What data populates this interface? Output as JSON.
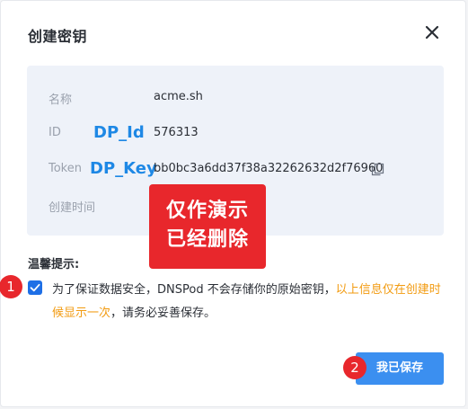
{
  "dialog": {
    "title": "创建密钥"
  },
  "fields": {
    "name_label": "名称",
    "name_value": "acme.sh",
    "id_label": "ID",
    "id_value": "576313",
    "token_label": "Token",
    "token_value": "bb0bc3a6dd37f38a32262632d2f76960",
    "created_label": "创建时间"
  },
  "annotations": {
    "id_tag": "DP_Id",
    "key_tag": "DP_Key",
    "overlay_line1": "仅作演示",
    "overlay_line2": "已经删除",
    "badge_1": "1",
    "badge_2": "2"
  },
  "tips": {
    "title": "温馨提示:",
    "text_part1": "为了保证数据安全，DNSPod 不会存储你的原始密钥，",
    "text_highlight": "以上信息仅在创建时候显示一次",
    "text_part2": "，请务必妥善保存。",
    "checked": true
  },
  "footer": {
    "confirm_label": "我已保存"
  },
  "colors": {
    "primary": "#3b8ff0",
    "checkbox": "#1e6fe6",
    "highlight": "#f29b11",
    "overlay": "#e8272c",
    "tag_blue": "#1e88e5",
    "panel_bg": "#eef2f9"
  },
  "icons": {
    "close": "close-icon",
    "copy": "copy-icon",
    "check": "check-icon"
  }
}
